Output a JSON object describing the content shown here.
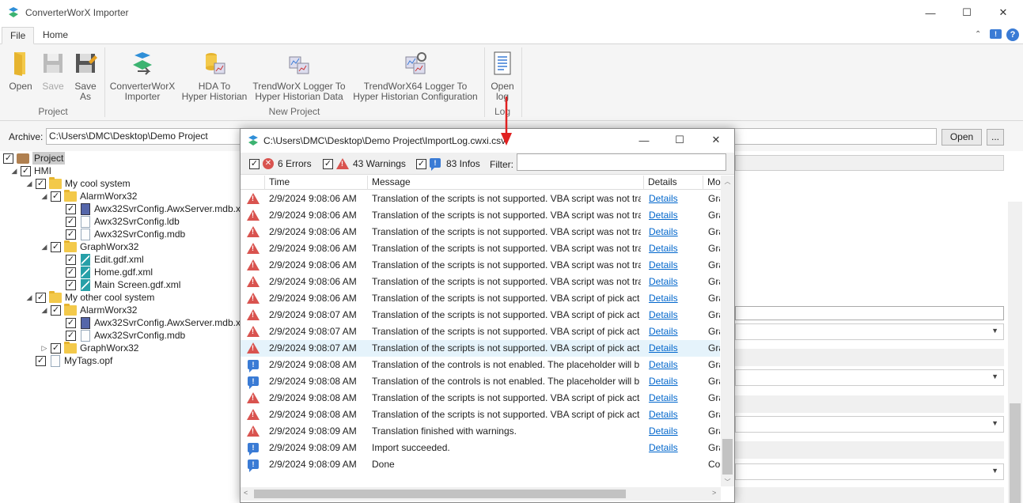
{
  "app": {
    "title": "ConverterWorX Importer",
    "minimize": "—",
    "maximize": "☐",
    "close": "✕"
  },
  "menu": {
    "file": "File",
    "home": "Home"
  },
  "ribbon": {
    "open": "Open",
    "save": "Save",
    "save_as_1": "Save",
    "save_as_2": "As",
    "converter_1": "ConverterWorX",
    "converter_2": "Importer",
    "hda_1": "HDA To",
    "hda_2": "Hyper Historian",
    "trend_1": "TrendWorX Logger To",
    "trend_2": "Hyper Historian Data",
    "trend64_1": "TrendWorX64 Logger To",
    "trend64_2": "Hyper Historian Configuration",
    "openlog_1": "Open",
    "openlog_2": "log",
    "group_project": "Project",
    "group_newproject": "New Project",
    "group_log": "Log"
  },
  "archive": {
    "label": "Archive:",
    "value": "C:\\Users\\DMC\\Desktop\\Demo Project",
    "open": "Open",
    "browse": "..."
  },
  "tree": [
    {
      "label": "Project",
      "level": 0,
      "kind": "project",
      "exp": ""
    },
    {
      "label": "HMI",
      "level": 1,
      "kind": "none",
      "exp": "◢"
    },
    {
      "label": "My cool system",
      "level": 2,
      "kind": "folder",
      "exp": "◢"
    },
    {
      "label": "AlarmWorx32",
      "level": 3,
      "kind": "folder",
      "exp": "◢"
    },
    {
      "label": "Awx32SvrConfig.AwxServer.mdb.x",
      "level": 4,
      "kind": "awx",
      "exp": ""
    },
    {
      "label": "Awx32SvrConfig.ldb",
      "level": 4,
      "kind": "file",
      "exp": ""
    },
    {
      "label": "Awx32SvrConfig.mdb",
      "level": 4,
      "kind": "file",
      "exp": ""
    },
    {
      "label": "GraphWorx32",
      "level": 3,
      "kind": "folder",
      "exp": "◢"
    },
    {
      "label": "Edit.gdf.xml",
      "level": 4,
      "kind": "x",
      "exp": ""
    },
    {
      "label": "Home.gdf.xml",
      "level": 4,
      "kind": "x",
      "exp": ""
    },
    {
      "label": "Main Screen.gdf.xml",
      "level": 4,
      "kind": "x",
      "exp": ""
    },
    {
      "label": "My other cool system",
      "level": 2,
      "kind": "folder",
      "exp": "◢"
    },
    {
      "label": "AlarmWorx32",
      "level": 3,
      "kind": "folder",
      "exp": "◢"
    },
    {
      "label": "Awx32SvrConfig.AwxServer.mdb.x",
      "level": 4,
      "kind": "awx",
      "exp": ""
    },
    {
      "label": "Awx32SvrConfig.mdb",
      "level": 4,
      "kind": "file",
      "exp": ""
    },
    {
      "label": "GraphWorx32",
      "level": 3,
      "kind": "folder",
      "exp": "▷"
    },
    {
      "label": "MyTags.opf",
      "level": 2,
      "kind": "file",
      "exp": ""
    }
  ],
  "dialog": {
    "title": "C:\\Users\\DMC\\Desktop\\Demo Project\\ImportLog.cwxi.csv",
    "errors": "6 Errors",
    "warnings": "43 Warnings",
    "infos": "83 Infos",
    "filter_label": "Filter:",
    "filter_value": "",
    "columns": {
      "time": "Time",
      "message": "Message",
      "details": "Details",
      "mo": "Mo"
    },
    "rows": [
      {
        "type": "warning",
        "time": "2/9/2024 9:08:06 AM",
        "msg": "Translation of the scripts is not supported. VBA script was not tra",
        "details": "Details",
        "mo": "Gra"
      },
      {
        "type": "warning",
        "time": "2/9/2024 9:08:06 AM",
        "msg": "Translation of the scripts is not supported. VBA script was not tra",
        "details": "Details",
        "mo": "Gra"
      },
      {
        "type": "warning",
        "time": "2/9/2024 9:08:06 AM",
        "msg": "Translation of the scripts is not supported. VBA script was not tra",
        "details": "Details",
        "mo": "Gra"
      },
      {
        "type": "warning",
        "time": "2/9/2024 9:08:06 AM",
        "msg": "Translation of the scripts is not supported. VBA script was not tra",
        "details": "Details",
        "mo": "Gra"
      },
      {
        "type": "warning",
        "time": "2/9/2024 9:08:06 AM",
        "msg": "Translation of the scripts is not supported. VBA script was not tra",
        "details": "Details",
        "mo": "Gra"
      },
      {
        "type": "warning",
        "time": "2/9/2024 9:08:06 AM",
        "msg": "Translation of the scripts is not supported. VBA script was not tra",
        "details": "Details",
        "mo": "Gra"
      },
      {
        "type": "warning",
        "time": "2/9/2024 9:08:06 AM",
        "msg": "Translation of the scripts is not supported. VBA script of pick act",
        "details": "Details",
        "mo": "Gra"
      },
      {
        "type": "warning",
        "time": "2/9/2024 9:08:07 AM",
        "msg": "Translation of the scripts is not supported. VBA script of pick act",
        "details": "Details",
        "mo": "Gra"
      },
      {
        "type": "warning",
        "time": "2/9/2024 9:08:07 AM",
        "msg": "Translation of the scripts is not supported. VBA script of pick act",
        "details": "Details",
        "mo": "Gra"
      },
      {
        "type": "warning",
        "time": "2/9/2024 9:08:07 AM",
        "msg": "Translation of the scripts is not supported. VBA script of pick act",
        "details": "Details",
        "mo": "Gra",
        "selected": true
      },
      {
        "type": "info",
        "time": "2/9/2024 9:08:08 AM",
        "msg": "Translation of the controls is not enabled. The placeholder will b",
        "details": "Details",
        "mo": "Gra"
      },
      {
        "type": "info",
        "time": "2/9/2024 9:08:08 AM",
        "msg": "Translation of the controls is not enabled. The placeholder will b",
        "details": "Details",
        "mo": "Gra"
      },
      {
        "type": "warning",
        "time": "2/9/2024 9:08:08 AM",
        "msg": "Translation of the scripts is not supported. VBA script of pick act",
        "details": "Details",
        "mo": "Gra"
      },
      {
        "type": "warning",
        "time": "2/9/2024 9:08:08 AM",
        "msg": "Translation of the scripts is not supported. VBA script of pick act",
        "details": "Details",
        "mo": "Gra"
      },
      {
        "type": "warning",
        "time": "2/9/2024 9:08:09 AM",
        "msg": "Translation finished with warnings.",
        "details": "Details",
        "mo": "Gra"
      },
      {
        "type": "info",
        "time": "2/9/2024 9:08:09 AM",
        "msg": "Import succeeded.",
        "details": "Details",
        "mo": "Gra"
      },
      {
        "type": "info",
        "time": "2/9/2024 9:08:09 AM",
        "msg": "Done",
        "details": "",
        "mo": "Co"
      }
    ]
  },
  "colors": {
    "accent": "#0066cc",
    "warning": "#d9534f",
    "info": "#3a7bd5",
    "arrow": "#e02020"
  }
}
